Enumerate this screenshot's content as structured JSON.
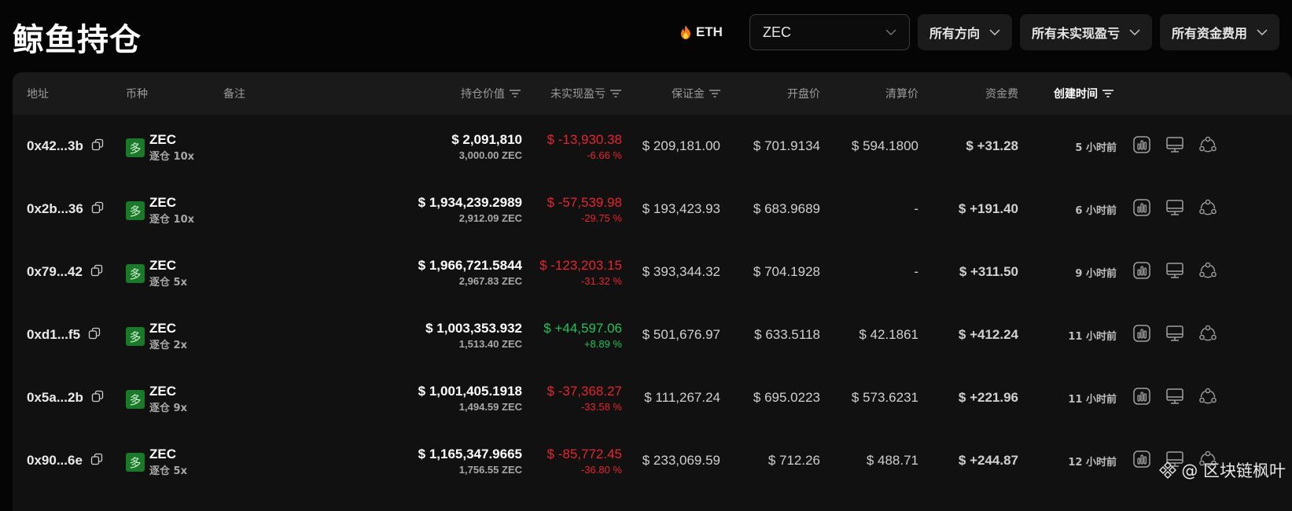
{
  "page": {
    "title": "鲸鱼持仓"
  },
  "filters": {
    "hot_label": "ETH",
    "coin_select": "ZEC",
    "direction": "所有方向",
    "unrealized": "所有未实现盈亏",
    "funding": "所有资金费用"
  },
  "headers": {
    "address": "地址",
    "coin": "币种",
    "note": "备注",
    "position_value": "持仓价值",
    "unrealized_pnl": "未实现盈亏",
    "margin": "保证金",
    "open_price": "开盘价",
    "liq_price": "清算价",
    "funding_fee": "资金费",
    "created_time": "创建时间"
  },
  "rows": [
    {
      "address": "0x42...3b",
      "side": "多",
      "coin": "ZEC",
      "mode": "逐仓 10x",
      "value": "$ 2,091,810",
      "qty": "3,000.00 ZEC",
      "pnl": "$ -13,930.38",
      "pnl_pct": "-6.66 %",
      "pnl_sign": "neg",
      "margin": "$ 209,181.00",
      "open": "$ 701.9134",
      "liq": "$ 594.1800",
      "fund": "$ +31.28",
      "time": "5 小时前"
    },
    {
      "address": "0x2b...36",
      "side": "多",
      "coin": "ZEC",
      "mode": "逐仓 10x",
      "value": "$ 1,934,239.2989",
      "qty": "2,912.09 ZEC",
      "pnl": "$ -57,539.98",
      "pnl_pct": "-29.75 %",
      "pnl_sign": "neg",
      "margin": "$ 193,423.93",
      "open": "$ 683.9689",
      "liq": "-",
      "fund": "$ +191.40",
      "time": "6 小时前"
    },
    {
      "address": "0x79...42",
      "side": "多",
      "coin": "ZEC",
      "mode": "逐仓 5x",
      "value": "$ 1,966,721.5844",
      "qty": "2,967.83 ZEC",
      "pnl": "$ -123,203.15",
      "pnl_pct": "-31.32 %",
      "pnl_sign": "neg",
      "margin": "$ 393,344.32",
      "open": "$ 704.1928",
      "liq": "-",
      "fund": "$ +311.50",
      "time": "9 小时前"
    },
    {
      "address": "0xd1...f5",
      "side": "多",
      "coin": "ZEC",
      "mode": "逐仓 2x",
      "value": "$ 1,003,353.932",
      "qty": "1,513.40 ZEC",
      "pnl": "$ +44,597.06",
      "pnl_pct": "+8.89 %",
      "pnl_sign": "pos",
      "margin": "$ 501,676.97",
      "open": "$ 633.5118",
      "liq": "$ 42.1861",
      "fund": "$ +412.24",
      "time": "11 小时前"
    },
    {
      "address": "0x5a...2b",
      "side": "多",
      "coin": "ZEC",
      "mode": "逐仓 9x",
      "value": "$ 1,001,405.1918",
      "qty": "1,494.59 ZEC",
      "pnl": "$ -37,368.27",
      "pnl_pct": "-33.58 %",
      "pnl_sign": "neg",
      "margin": "$ 111,267.24",
      "open": "$ 695.0223",
      "liq": "$ 573.6231",
      "fund": "$ +221.96",
      "time": "11 小时前"
    },
    {
      "address": "0x90...6e",
      "side": "多",
      "coin": "ZEC",
      "mode": "逐仓 5x",
      "value": "$ 1,165,347.9665",
      "qty": "1,756.55 ZEC",
      "pnl": "$ -85,772.45",
      "pnl_pct": "-36.80 %",
      "pnl_sign": "neg",
      "margin": "$ 233,069.59",
      "open": "$ 712.26",
      "liq": "$ 488.71",
      "fund": "$ +244.87",
      "time": "12 小时前"
    }
  ],
  "colors": {
    "negative": "#e5252e",
    "positive": "#1fc25a",
    "long_badge": "#1a7a2a"
  },
  "icons": {
    "copy": "copy-icon",
    "chart": "chart-icon",
    "monitor": "monitor-icon",
    "share": "share-icon",
    "flame": "flame-icon"
  },
  "watermark": "@ 区块链枫叶"
}
